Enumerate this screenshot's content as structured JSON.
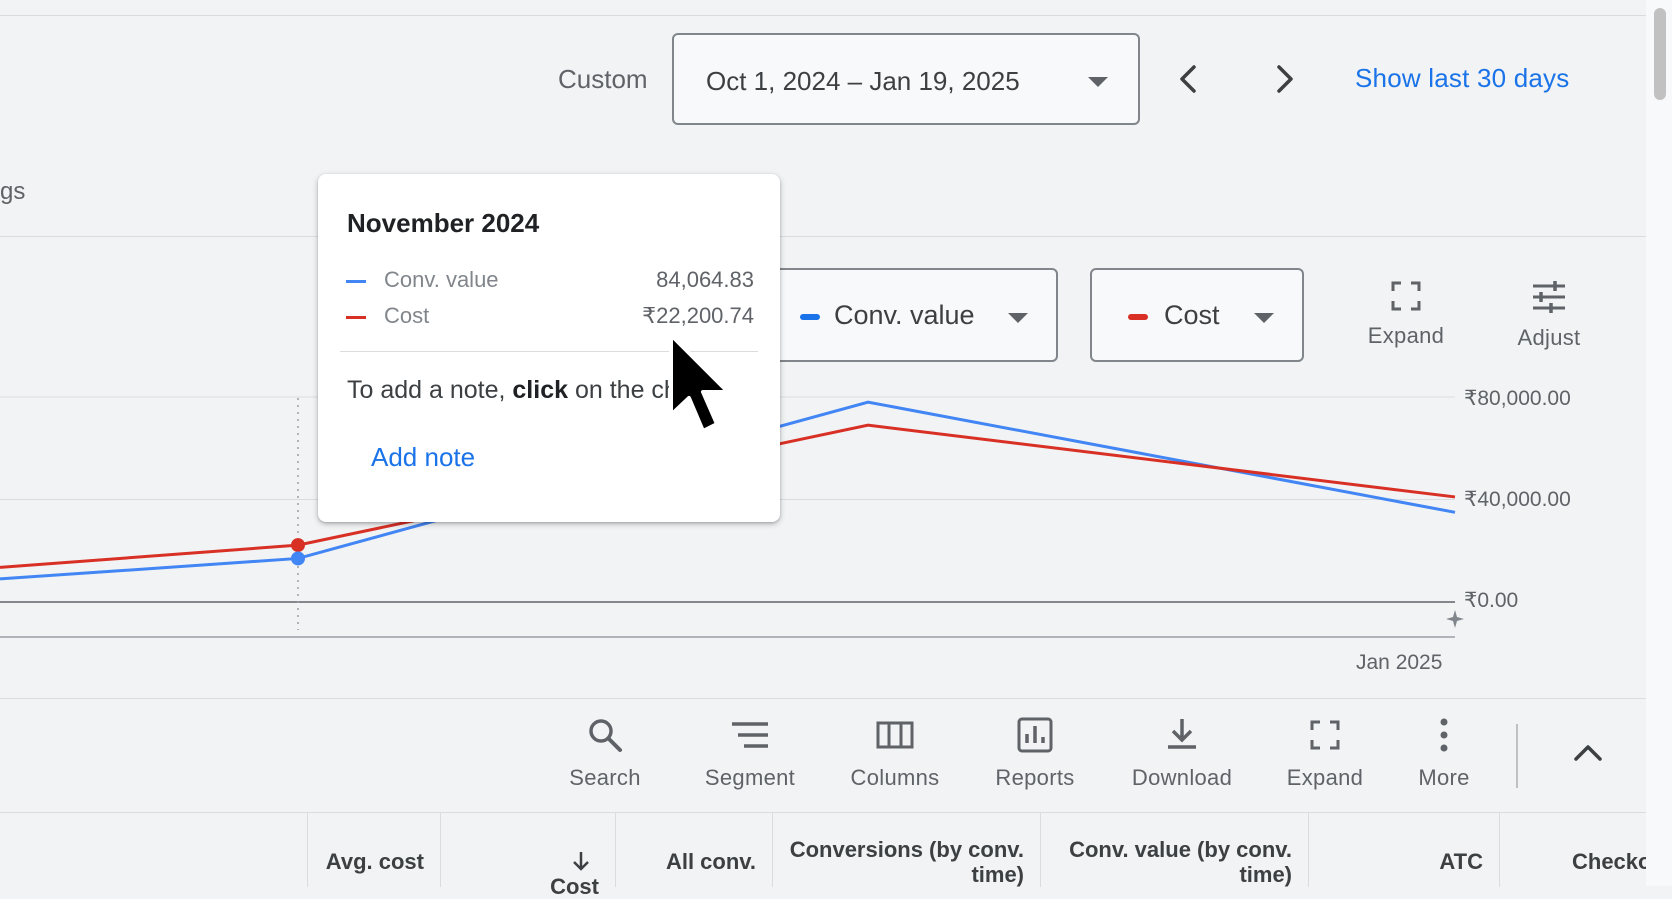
{
  "date_bar": {
    "range_label": "Custom",
    "date_range": "Oct 1, 2024 – Jan 19, 2025",
    "show_last_30": "Show last 30 days"
  },
  "cutoff_text": "gs",
  "metrics": {
    "metric1": {
      "label": "Conv. value",
      "color": "#1a73e8"
    },
    "metric2": {
      "label": "Cost",
      "color": "#d93025"
    }
  },
  "chart_tools": {
    "expand": "Expand",
    "adjust": "Adjust"
  },
  "tooltip": {
    "title": "November 2024",
    "rows": [
      {
        "name": "Conv. value",
        "value": "84,064.83"
      },
      {
        "name": "Cost",
        "value": "₹22,200.74"
      }
    ],
    "note_prefix": "To add a note, ",
    "note_bold": "click",
    "note_suffix": " on the chart",
    "add_note": "Add note"
  },
  "chart_data": {
    "type": "line",
    "x_label_visible": "Jan 2025",
    "y_ticks": [
      "₹80,000.00",
      "₹40,000.00",
      "₹0.00"
    ],
    "ylim": [
      0,
      80000
    ],
    "series": [
      {
        "name": "Conv. value",
        "color": "#4285f4",
        "values": [
          {
            "x": "Nov 2024",
            "y": 17000
          },
          {
            "x": "Dec 2024",
            "y": 78000
          },
          {
            "x": "Jan 2025",
            "y": 35000
          }
        ]
      },
      {
        "name": "Cost",
        "color": "#d93025",
        "values": [
          {
            "x": "Nov 2024",
            "y": 22200
          },
          {
            "x": "Dec 2024",
            "y": 69000
          },
          {
            "x": "Jan 2025",
            "y": 41000
          }
        ]
      }
    ]
  },
  "toolbar": {
    "search": "Search",
    "segment": "Segment",
    "columns": "Columns",
    "reports": "Reports",
    "download": "Download",
    "expand": "Expand",
    "more": "More"
  },
  "table_header": {
    "avg_cost": "Avg. cost",
    "cost": "Cost",
    "all_conv": "All conv.",
    "conversions_l1": "Conversions (by conv.",
    "conversions_l2": "time)",
    "conv_value_l1": "Conv. value (by conv.",
    "conv_value_l2": "time)",
    "atc": "ATC",
    "checkout": "Checko"
  }
}
